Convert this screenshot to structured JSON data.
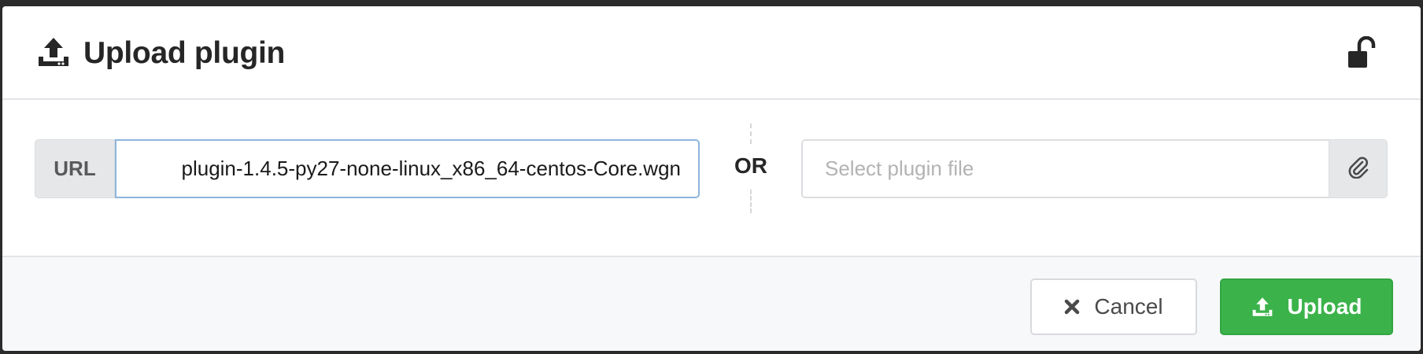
{
  "dialog": {
    "title": "Upload plugin",
    "header_icon": "upload-icon",
    "lock_icon": "unlocked-lock-icon"
  },
  "url_section": {
    "label": "URL",
    "value": "plugin-1.4.5-py27-none-linux_x86_64-centos-Core.wgn"
  },
  "divider": {
    "text": "OR"
  },
  "file_section": {
    "placeholder": "Select plugin file",
    "attach_icon": "paperclip-icon"
  },
  "footer": {
    "cancel_label": "Cancel",
    "cancel_icon": "close-icon",
    "upload_label": "Upload",
    "upload_icon": "upload-icon"
  },
  "colors": {
    "primary_green": "#3bb34a",
    "focus_border": "#8eb5dc",
    "text_dark": "#262626"
  }
}
